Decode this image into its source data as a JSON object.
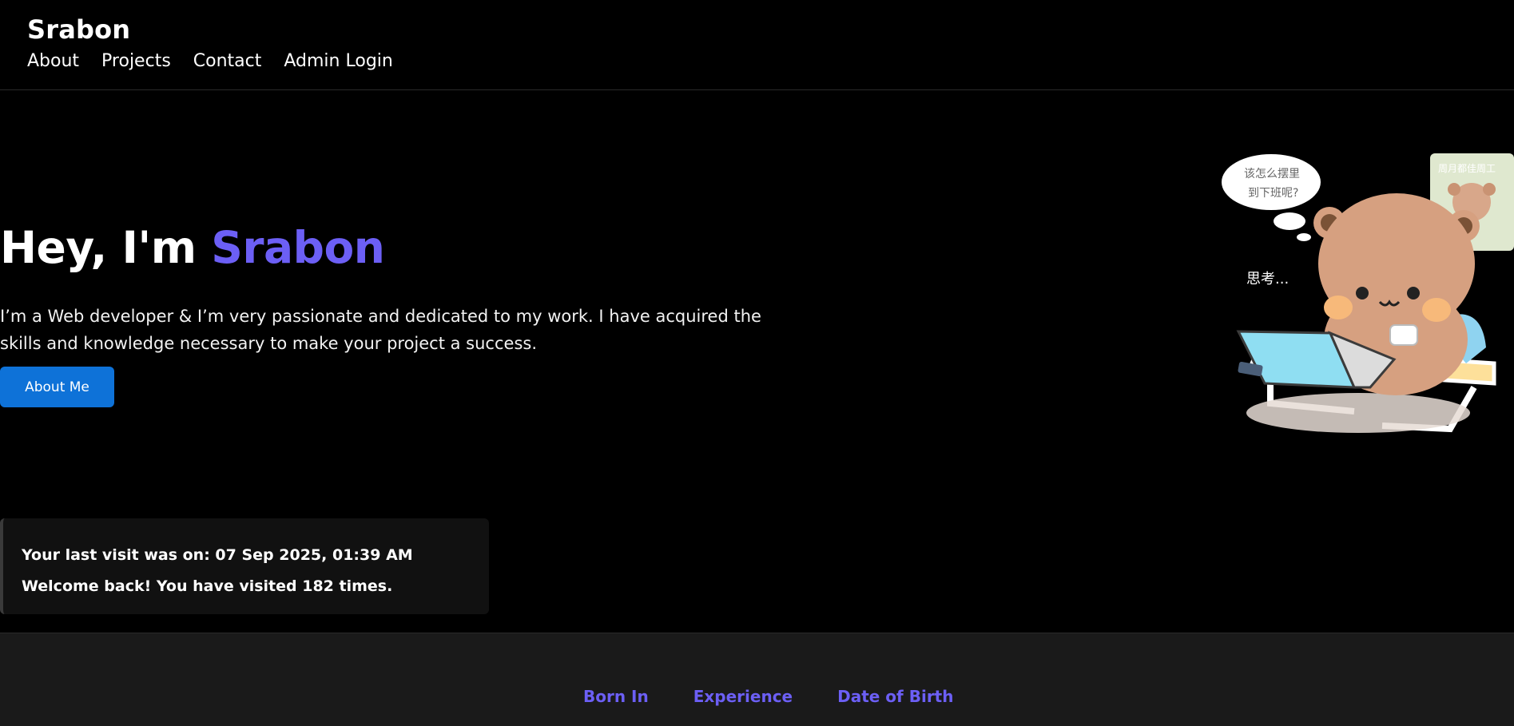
{
  "header": {
    "brand": "Srabon",
    "nav": [
      "About",
      "Projects",
      "Contact",
      "Admin Login"
    ]
  },
  "hero": {
    "greeting": "Hey, I'm",
    "name": "Srabon",
    "description": "I’m a Web developer & I’m very passionate and dedicated to my work. I have acquired the skills and knowledge necessary to make your project a success.",
    "button_label": "About Me",
    "accent_color": "#6c5ff5",
    "button_color": "#0e72d8",
    "illustration": {
      "bubble_text_line1": "该怎么摆里",
      "bubble_text_line2": "到下班呢?",
      "thinking_text": "思考...",
      "poster_text": "周月都佳周工"
    }
  },
  "visit": {
    "last_visit": "Your last visit was on: 07 Sep 2025, 01:39 AM",
    "welcome": "Welcome back! You have visited 182 times."
  },
  "stats": {
    "labels": [
      "Born In",
      "Experience",
      "Date of Birth"
    ]
  }
}
